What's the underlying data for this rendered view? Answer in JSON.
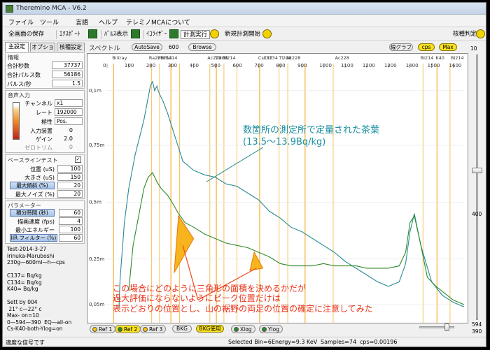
{
  "window": {
    "title": "Theremino MCA - V6.2"
  },
  "menu": [
    "ファイル",
    "ツール",
    "言語",
    "ヘルプ",
    "テレミノMCAについて"
  ],
  "toolbar": {
    "save_screen": "全画面の保存",
    "export": "ｴｸｽﾎﾟｰﾄ",
    "pulse_display": "ﾊﾟﾙｽ表示",
    "equalizer": "ｲｺﾗｲｻﾞｰ",
    "measure_run": "計測実行",
    "new_measure": "新規計測開始",
    "nuclide_id": "核種判定"
  },
  "tabs": [
    "主設定",
    "オプション",
    "核種設定"
  ],
  "info": {
    "title": "情報",
    "rows": [
      {
        "label": "合計秒数",
        "value": "37737"
      },
      {
        "label": "合計パルス数",
        "value": "56186"
      },
      {
        "label": "パルス/秒",
        "value": "1.5"
      }
    ]
  },
  "audio": {
    "title": "音声入力",
    "rows": [
      {
        "label": "チャンネル",
        "value": "x1"
      },
      {
        "label": "レート",
        "value": "192000"
      },
      {
        "label": "極性",
        "value": "Pos."
      },
      {
        "label": "入力装置",
        "value": "0"
      },
      {
        "label": "ゲイン",
        "value": "2.0"
      },
      {
        "label": "ゼロトリム",
        "value": "0"
      }
    ]
  },
  "baseline": {
    "title": "ベースラインテスト",
    "checked": "✓",
    "rows": [
      {
        "label": "位置 (uS)",
        "value": "100"
      },
      {
        "label": "大きさ (uS)",
        "value": "150"
      },
      {
        "label": "最大傾斜 (%)",
        "value": "20"
      },
      {
        "label": "最大ノイズ (%)",
        "value": "20"
      }
    ]
  },
  "params": {
    "title": "パラメーター",
    "rows": [
      {
        "label": "積分時間 (秒)",
        "value": "60"
      },
      {
        "label": "描画速度 (fps)",
        "value": "4"
      },
      {
        "label": "最小エネルギー",
        "value": "100"
      },
      {
        "label": "IIR フィルター (%)",
        "value": "60"
      }
    ]
  },
  "info_text": "Test-2014-3-27\nIrinuka-Maruboshi\n230g—600ml—h—cps\n\nC137= Bq/kg\nC134= Bq/kg\nK40= Bq/kg\n\nSett by 004\n 21° c—22° c\nMax- on=10\n0—594—390  EQ—all-on\nCs-K40-both-Ylog=on",
  "spectrum": {
    "title": "スペクトル",
    "autosave": "AutoSave",
    "autosave_value": "600",
    "browse": "Browse",
    "line_graph": "線グラフ",
    "cps": "cps",
    "max": "Max",
    "right_top": "10"
  },
  "chart_data": {
    "type": "line",
    "x_ticks": [
      0,
      100,
      200,
      300,
      400,
      500,
      600,
      700,
      800,
      900,
      1000,
      1100,
      1200,
      1300,
      1400,
      1500,
      1600
    ],
    "y_ticks": [
      "0,1m",
      "0,75m",
      "0,5m",
      "0,25m",
      "0,05m"
    ],
    "isotopes": [
      "BiXray",
      "Ra226",
      "Pb214",
      "Pb214",
      "Ac228",
      "Tl208",
      "Bi214",
      "Cs137",
      "Cs134",
      "Tl208",
      "Ac228",
      "Ac228",
      "Bi214",
      "K40",
      "Bi214",
      "Ac228"
    ],
    "series": [
      {
        "name": "",
        "color": "#2a8a92",
        "x": [
          55,
          60,
          80,
          100,
          130,
          170,
          190,
          200,
          210,
          220,
          230,
          240,
          260,
          280,
          300,
          330,
          350,
          400,
          450,
          500,
          550,
          600,
          650,
          700,
          750,
          800,
          850,
          900,
          950,
          1000,
          1050,
          1100,
          1150,
          1200,
          1250,
          1300,
          1350,
          1380,
          1400,
          1420,
          1450,
          1500,
          1550,
          1600,
          1650
        ],
        "y": [
          0.025,
          0.15,
          0.4,
          0.55,
          0.7,
          0.85,
          0.95,
          1.0,
          1.02,
          0.98,
          1.0,
          0.97,
          0.93,
          0.88,
          0.82,
          0.73,
          0.67,
          0.63,
          0.61,
          0.6,
          0.57,
          0.56,
          0.53,
          0.5,
          0.45,
          0.42,
          0.38,
          0.36,
          0.33,
          0.3,
          0.27,
          0.23,
          0.2,
          0.17,
          0.14,
          0.12,
          0.14,
          0.22,
          0.36,
          0.44,
          0.3,
          0.14,
          0.08,
          0.05,
          0.03
        ]
      },
      {
        "name": "",
        "color": "#2f8a28",
        "x": [
          100,
          120,
          150,
          170,
          190,
          210,
          230,
          250,
          280,
          300,
          330,
          360,
          400,
          450,
          500,
          550,
          600,
          650,
          700,
          750,
          800,
          850,
          900,
          950,
          1000,
          1050,
          1100,
          1150,
          1200,
          1250,
          1300,
          1350,
          1380,
          1400,
          1420,
          1450,
          1480,
          1520,
          1600,
          1650
        ],
        "y": [
          0.1,
          0.3,
          0.45,
          0.55,
          0.6,
          0.62,
          0.58,
          0.55,
          0.52,
          0.49,
          0.44,
          0.4,
          0.38,
          0.35,
          0.33,
          0.31,
          0.3,
          0.29,
          0.27,
          0.25,
          0.22,
          0.21,
          0.21,
          0.21,
          0.22,
          0.21,
          0.21,
          0.21,
          0.2,
          0.2,
          0.2,
          0.21,
          0.27,
          0.4,
          0.43,
          0.3,
          0.16,
          0.12,
          0.06,
          0.04
        ]
      }
    ],
    "annotations": {
      "label1": "数箇所の測定所で定量された茶葉",
      "label2": "(13.5～13.9Bq/kg)",
      "note1": "この場合にどのように三角形の面積を決めるかだが",
      "note2": "過大評価にならないようにピーク位置だけは",
      "note3": "表示どおりの位置とし、山の裾野の両足の位置の確定に注意してみた"
    }
  },
  "bottom": {
    "ref1": "Ref 1",
    "ref2": "Ref 2",
    "ref3": "Ref 3",
    "bkg": "BKG",
    "bkg_use": "BKG使用",
    "xlog": "Xlog",
    "ylog": "Ylog"
  },
  "right": {
    "v400": "400",
    "v594": "594",
    "v390": "390"
  },
  "status": {
    "left": "適度な信号です",
    "selected": "Selected Bin=6",
    "energy": "Energy=9.3 KeV",
    "samples": "Samples=74",
    "cps": "cps=0.00196"
  }
}
